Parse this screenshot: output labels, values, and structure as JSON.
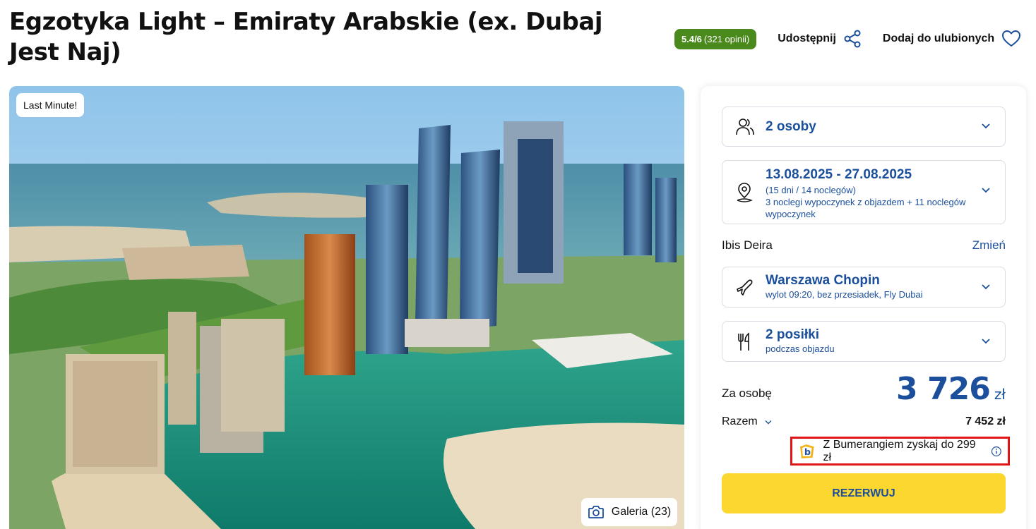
{
  "header": {
    "title": "Egzotyka Light – Emiraty Arabskie (ex. Dubaj Jest Naj)",
    "rating": {
      "score": "5.4/6",
      "count": "(321 opinii)"
    },
    "share_label": "Udostępnij",
    "favorite_label": "Dodaj do ulubionych"
  },
  "hero": {
    "badge": "Last Minute!",
    "gallery_label": "Galeria (23)"
  },
  "booking": {
    "persons": {
      "label": "2 osoby",
      "icon": "people-icon"
    },
    "dates": {
      "range": "13.08.2025 - 27.08.2025",
      "duration": "(15 dni / 14 noclegów)",
      "details": "3 noclegi wypoczynek z objazdem + 11 noclegów wypoczynek",
      "icon": "location-pin-icon"
    },
    "hotel": {
      "name": "Ibis Deira",
      "change_label": "Zmień"
    },
    "flight": {
      "airport": "Warszawa Chopin",
      "details": "wylot 09:20, bez przesiadek, Fly Dubai",
      "icon": "plane-icon"
    },
    "meals": {
      "label": "2 posiłki",
      "details": "podczas objazdu",
      "icon": "cutlery-icon"
    },
    "price": {
      "per_person_label": "Za osobę",
      "per_person_value": "3 726",
      "currency": "zł",
      "total_label": "Razem",
      "total_value": "7 452 zł"
    },
    "bumerang_text": "Z Bumerangiem zyskaj do 299 zł",
    "reserve_label": "REZERWUJ"
  },
  "colors": {
    "brand_blue": "#1b4f9c",
    "rating_green": "#4a8a1c",
    "reserve_yellow": "#fbd730",
    "highlight_red": "#e01414"
  }
}
